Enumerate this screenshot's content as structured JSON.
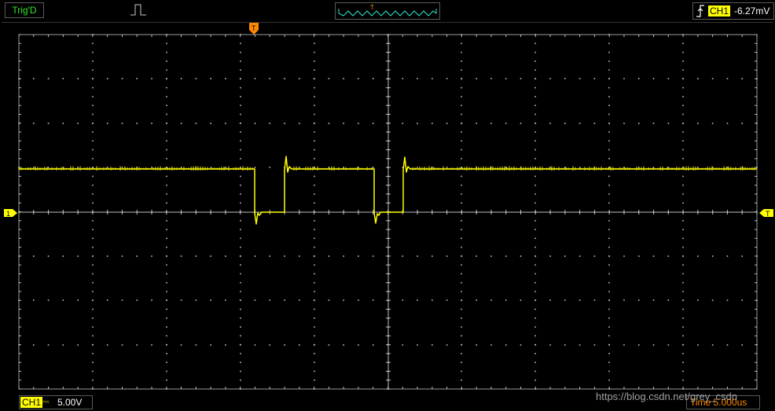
{
  "top_bar": {
    "trigger_status": "Trig'D",
    "trigger_source": "CH1",
    "trigger_level": "-6.27mV"
  },
  "overview": {
    "trigger_marker": "T"
  },
  "markers": {
    "trigger_position": "T",
    "channel1": "1"
  },
  "bottom_bar": {
    "channel": "CH1",
    "scale": "5.00V",
    "timebase": "Time 5.000us"
  },
  "watermark": "https://blog.csdn.net/grey_csdn",
  "colors": {
    "trace": "#ffff00",
    "trigger_marker": "#ff8a00",
    "grid": "#bfbfbf",
    "status_text": "#2ee82e"
  },
  "icons": [
    "pulse-icon",
    "rising-edge-icon"
  ]
}
